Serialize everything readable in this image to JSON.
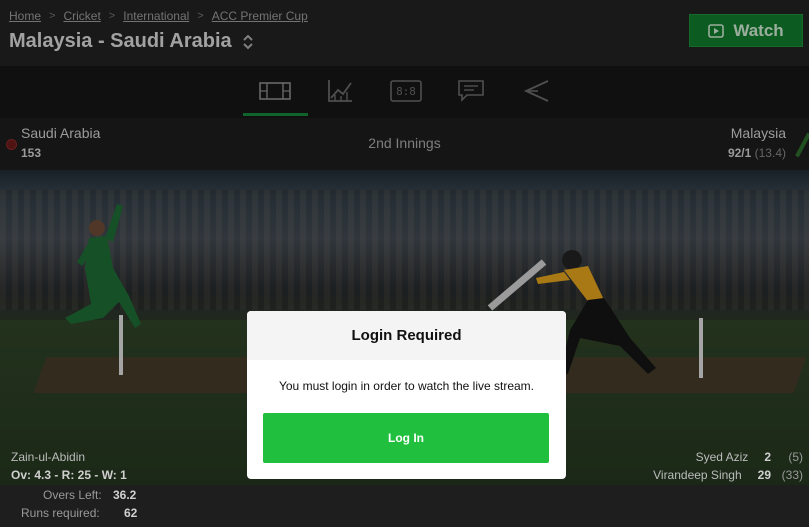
{
  "breadcrumbs": [
    "Home",
    "Cricket",
    "International",
    "ACC Premier Cup"
  ],
  "match_title": "Malaysia - Saudi Arabia",
  "watch_label": "Watch",
  "tabs": [
    "pitch-view-icon",
    "stats-chart-icon",
    "scoreboard-icon",
    "commentary-icon",
    "lineups-icon"
  ],
  "score": {
    "left_team": "Saudi Arabia",
    "left_score": "153",
    "innings": "2nd Innings",
    "right_team": "Malaysia",
    "right_score": "92/1",
    "right_overs": "(13.4)"
  },
  "modal": {
    "title": "Login Required",
    "message": "You must login in order to watch the live stream.",
    "button": "Log In"
  },
  "bowler": {
    "name": "Zain-ul-Abidin",
    "stats": "Ov: 4.3 - R: 25 - W: 1"
  },
  "batsmen": [
    {
      "name": "Syed Aziz",
      "runs": "2",
      "balls": "(5)"
    },
    {
      "name": "Virandeep Singh",
      "runs": "29",
      "balls": "(33)"
    }
  ],
  "footer": {
    "overs_left_label": "Overs Left:",
    "overs_left_value": "36.2",
    "runs_required_label": "Runs required:",
    "runs_required_value": "62"
  },
  "colors": {
    "accent_green": "#20c03e",
    "watch_green": "#107a2c",
    "tab_underline": "#15853a"
  }
}
